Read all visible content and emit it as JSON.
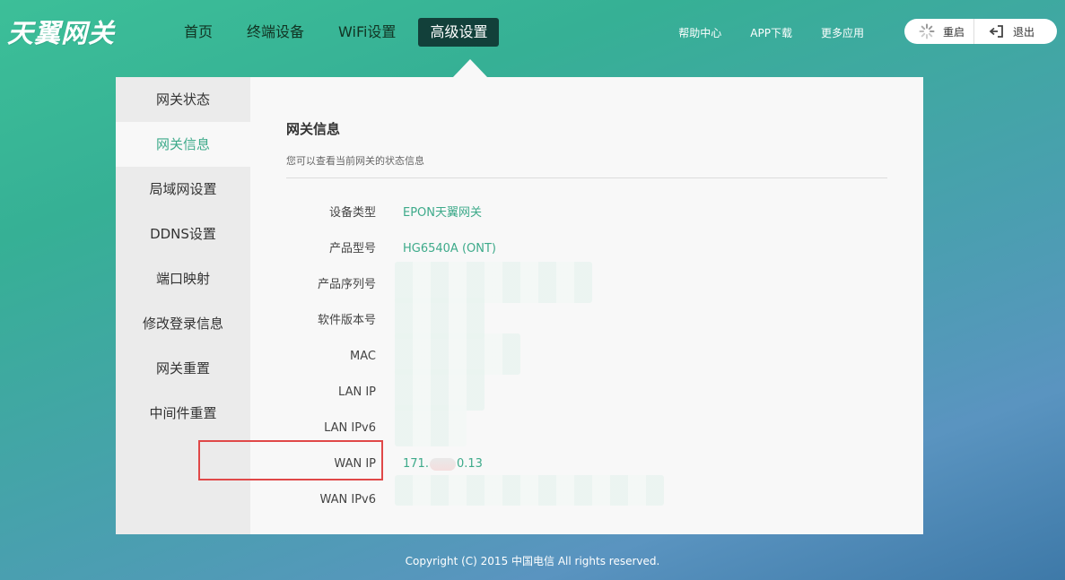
{
  "header": {
    "logo": "天翼网关",
    "nav": [
      {
        "label": "首页",
        "active": false
      },
      {
        "label": "终端设备",
        "active": false
      },
      {
        "label": "WiFi设置",
        "active": false
      },
      {
        "label": "高级设置",
        "active": true
      }
    ],
    "links": [
      "帮助中心",
      "APP下载",
      "更多应用"
    ],
    "restart_label": "重启",
    "logout_label": "退出"
  },
  "sidebar": {
    "items": [
      {
        "label": "网关状态",
        "active": false
      },
      {
        "label": "网关信息",
        "active": true
      },
      {
        "label": "局域网设置",
        "active": false
      },
      {
        "label": "DDNS设置",
        "active": false
      },
      {
        "label": "端口映射",
        "active": false
      },
      {
        "label": "修改登录信息",
        "active": false
      },
      {
        "label": "网关重置",
        "active": false
      },
      {
        "label": "中间件重置",
        "active": false
      }
    ]
  },
  "main": {
    "title": "网关信息",
    "subtitle": "您可以查看当前网关的状态信息",
    "rows": [
      {
        "label": "设备类型",
        "value": "EPON天翼网关"
      },
      {
        "label": "产品型号",
        "value": "HG6540A (ONT)"
      },
      {
        "label": "产品序列号",
        "value": ""
      },
      {
        "label": "软件版本号",
        "value": ""
      },
      {
        "label": "MAC",
        "value": ""
      },
      {
        "label": "LAN IP",
        "value": ""
      },
      {
        "label": "LAN IPv6",
        "value": ""
      },
      {
        "label": "WAN IP",
        "value_prefix": "171.",
        "value_suffix": "0.13"
      },
      {
        "label": "WAN IPv6",
        "value": ""
      }
    ]
  },
  "footer": {
    "text": "Copyright (C) 2015 中国电信 All rights reserved."
  },
  "colors": {
    "accent": "#3daa8a",
    "nav_active": "#12403a",
    "highlight_box": "#e04848"
  }
}
